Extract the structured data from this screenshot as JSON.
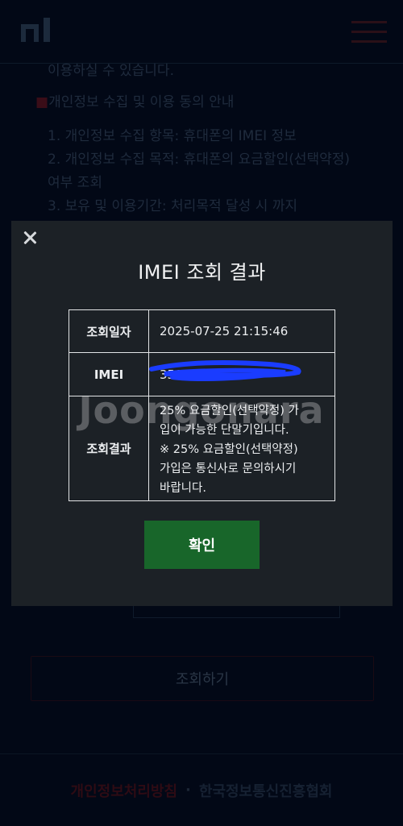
{
  "background": {
    "lines": [
      "이용하실 수 있습니다.",
      "개인정보 수집 및 이용 동의 안내",
      "1. 개인정보 수집 항목: 휴대폰의 IMEI 정보",
      "2. 개인정보 수집 목적: 휴대폰의 요금할인(선택약정)",
      "여부 조회",
      "3. 보유 및 이용기간: 처리목적 달성 시 까지"
    ],
    "bullet": "■",
    "submit_label": "조회하기",
    "footer": {
      "privacy_link": "개인정보처리방침",
      "separator": "·",
      "org_link": "한국정보통신진흥협회"
    }
  },
  "modal": {
    "title": "IMEI 조회 결과",
    "rows": [
      {
        "label": "조회일자",
        "value": "2025-07-25 21:15:46"
      },
      {
        "label": "IMEI",
        "value": "350"
      },
      {
        "label": "조회결과",
        "value": "25% 요금할인(선택약정) 가입이 가능한 단말기입니다. ※ 25% 요금할인(선택약정) 가입은 통신사로 문의하시기 바랍니다."
      }
    ],
    "result_lines": [
      "25% 요금할인(선택약정) 가",
      "입이 가능한 단말기입니다.",
      "※ 25% 요금할인(선택약정)",
      "가입은 통신사로 문의하시기",
      "바랍니다."
    ],
    "confirm_label": "확인"
  },
  "watermark": "Joongonara",
  "colors": {
    "confirm_bg": "#18662a",
    "modal_bg": "#1c2126",
    "redaction": "#1a3cff"
  }
}
